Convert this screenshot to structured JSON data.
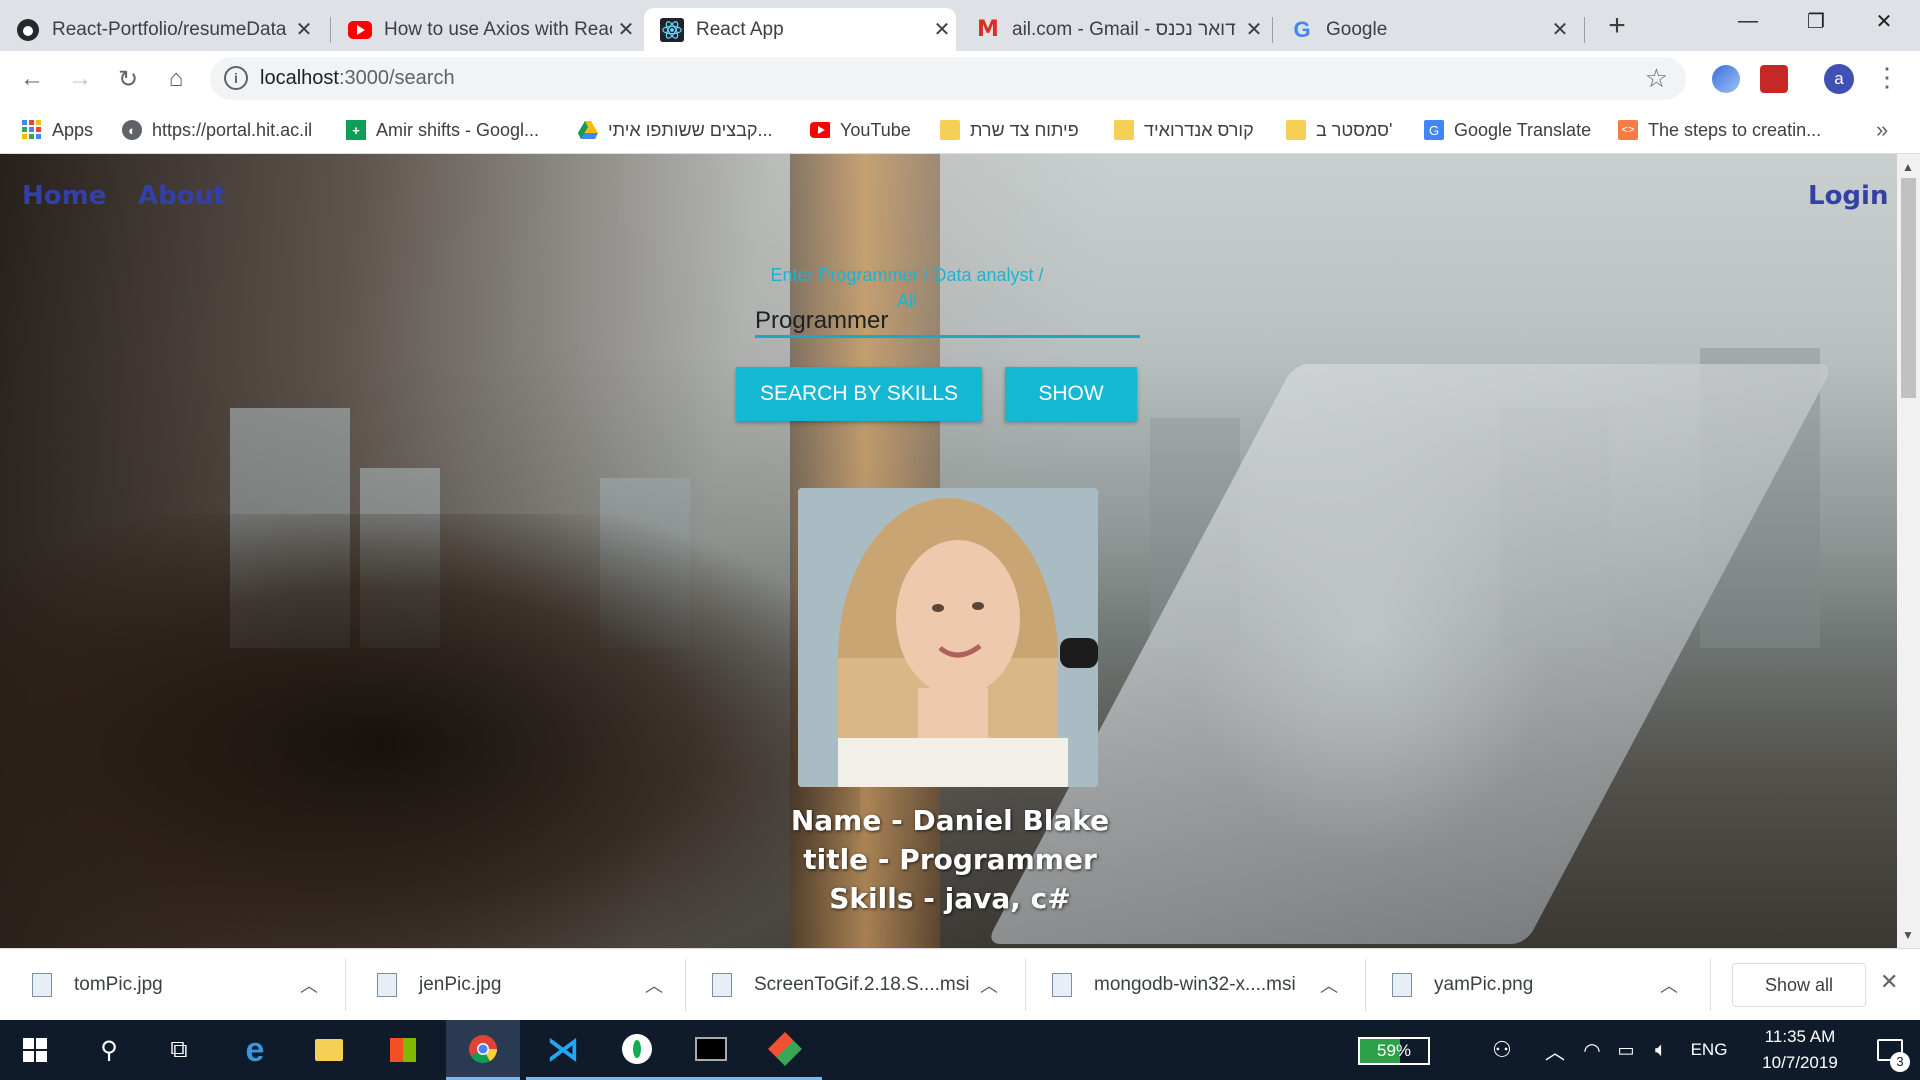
{
  "tabs": [
    {
      "title": "React-Portfolio/resumeData",
      "icon": "github-icon"
    },
    {
      "title": "How to use Axios with React",
      "icon": "youtube-icon"
    },
    {
      "title": "React App",
      "icon": "react-icon",
      "active": true
    },
    {
      "title": "ail.com - Gmail - דואר נכנס",
      "icon": "gmail-icon"
    },
    {
      "title": "Google",
      "icon": "google-icon"
    }
  ],
  "address": {
    "host": "localhost",
    "path": ":3000/search"
  },
  "profile_initial": "a",
  "bookmarks": [
    {
      "label": "Apps",
      "icon": "apps-grid-icon"
    },
    {
      "label": "https://portal.hit.ac.il",
      "icon": "globe-icon"
    },
    {
      "label": "Amir shifts - Googl...",
      "icon": "sheets-icon"
    },
    {
      "label": "קבצים ששותפו איתי...",
      "icon": "drive-icon"
    },
    {
      "label": "YouTube",
      "icon": "youtube-icon"
    },
    {
      "label": "פיתוח צד שרת",
      "icon": "folder-icon"
    },
    {
      "label": "קורס אנדרואיד",
      "icon": "folder-icon"
    },
    {
      "label": "סמסטר ב'",
      "icon": "folder-icon"
    },
    {
      "label": "Google Translate",
      "icon": "translate-icon"
    },
    {
      "label": "The steps to creatin...",
      "icon": "code-icon"
    }
  ],
  "nav": {
    "home": "Home",
    "about": "About",
    "login": "Login"
  },
  "search": {
    "label": "Enter Programmer / Data analyst / All",
    "value": "Programmer"
  },
  "buttons": {
    "search_skills": "SEARCH BY SKILLS",
    "show": "SHOW"
  },
  "result": {
    "name_line": "Name - Daniel Blake",
    "title_line": "title - Programmer",
    "skills_line": "Skills - java, c#"
  },
  "downloads": [
    "tomPic.jpg",
    "jenPic.jpg",
    "ScreenToGif.2.18.S....msi",
    "mongodb-win32-x....msi",
    "yamPic.png"
  ],
  "downloads_show_all": "Show all",
  "taskbar": {
    "battery": "59%",
    "language": "ENG",
    "time": "11:35 AM",
    "date": "10/7/2019",
    "notifications": "3"
  },
  "colors": {
    "accent": "#14b8d2",
    "nav_link": "#3340a8",
    "taskbar": "#0f1b2a"
  }
}
